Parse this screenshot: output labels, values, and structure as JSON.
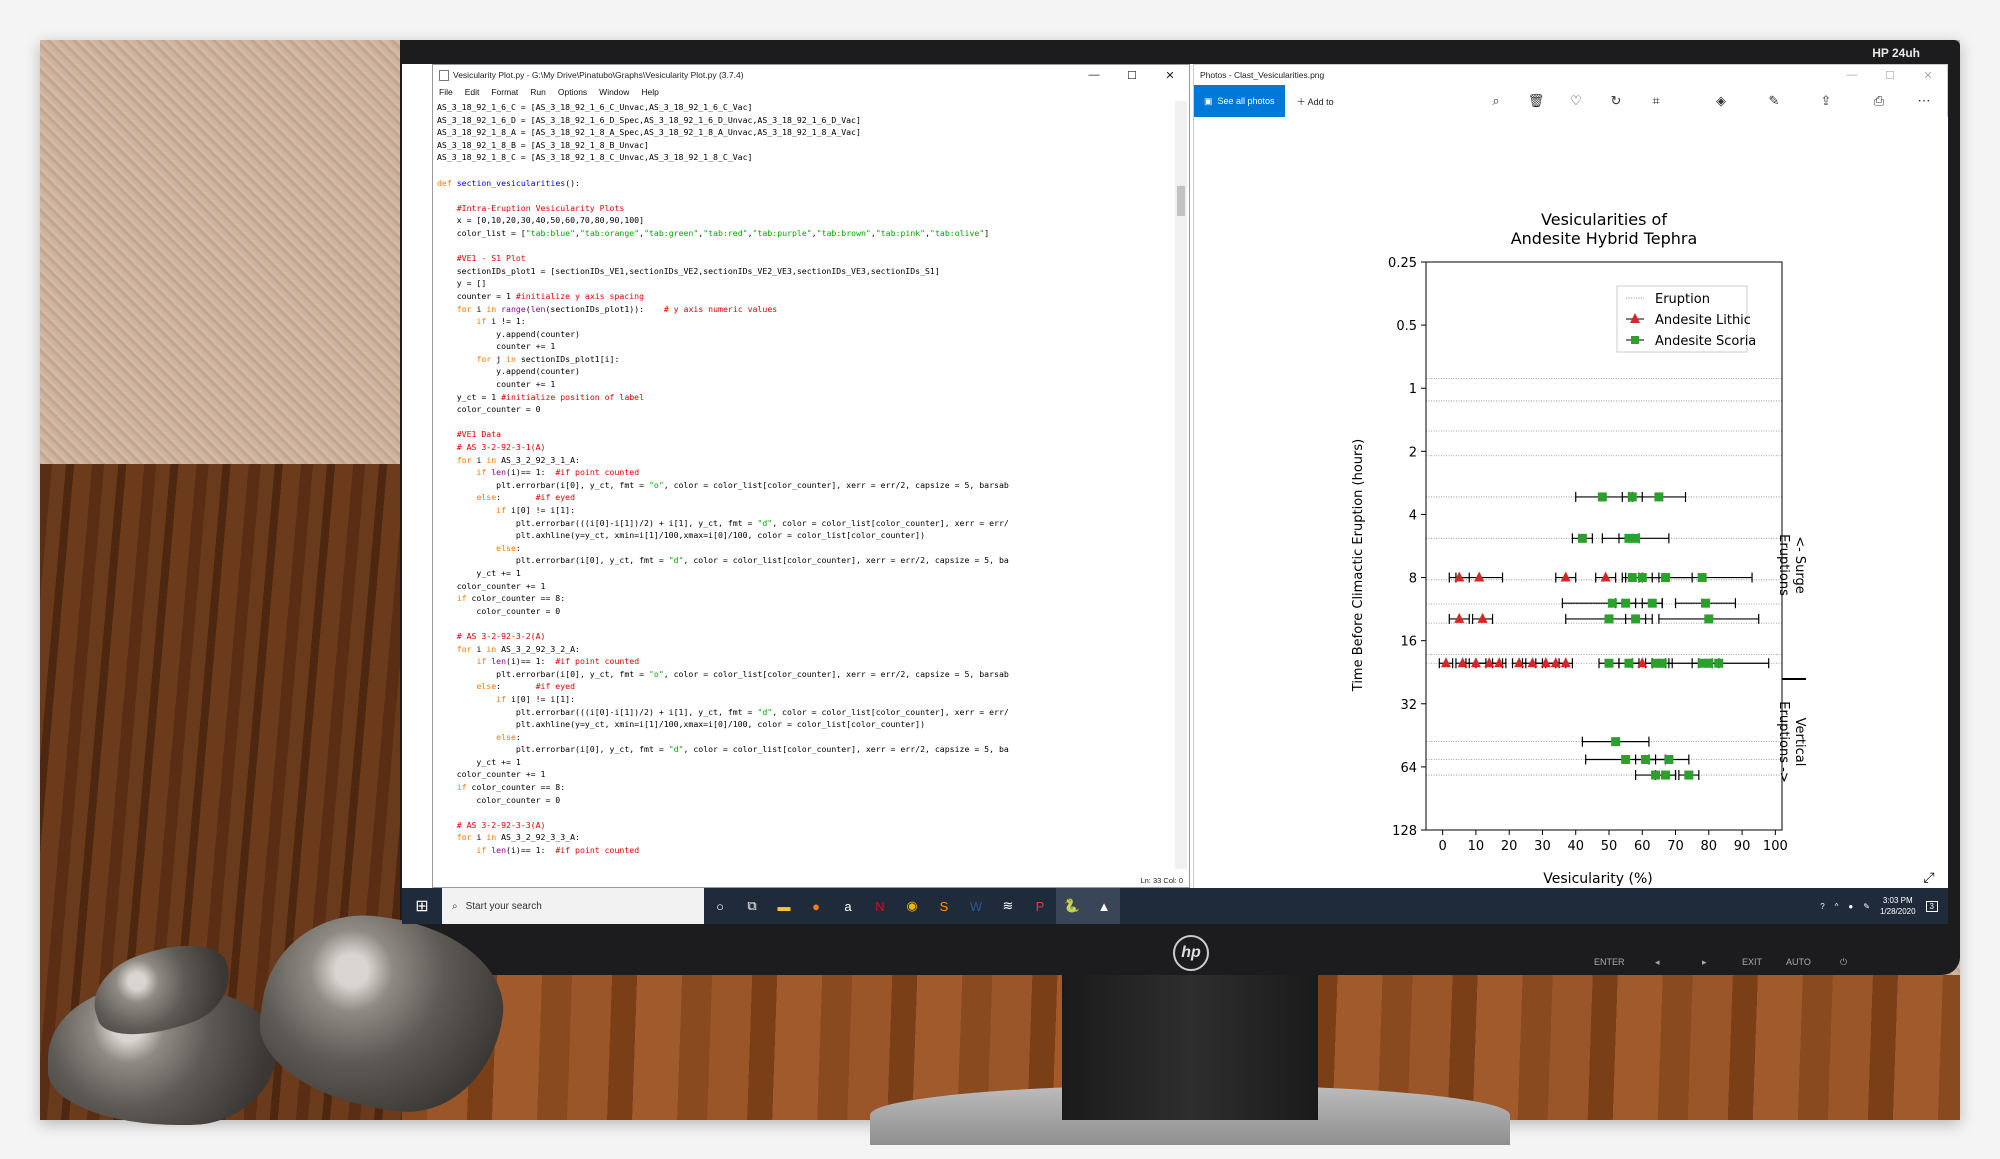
{
  "monitor": {
    "brand": "HP 24uh",
    "logo": "hp",
    "buttons": [
      "ENTER",
      "◂",
      "▸",
      "EXIT",
      "AUTO",
      "⏻"
    ]
  },
  "idle_window": {
    "title": "Vesicularity Plot.py - G:\\My Drive\\Pinatubo\\Graphs\\Vesicularity Plot.py (3.7.4)",
    "menu": [
      "File",
      "Edit",
      "Format",
      "Run",
      "Options",
      "Window",
      "Help"
    ],
    "status": "Ln: 33   Col: 0",
    "code_lines": [
      "AS_3_18_92_1_6_C = [AS_3_18_92_1_6_C_Unvac,AS_3_18_92_1_6_C_Vac]",
      "AS_3_18_92_1_6_D = [AS_3_18_92_1_6_D_Spec,AS_3_18_92_1_6_D_Unvac,AS_3_18_92_1_6_D_Vac]",
      "AS_3_18_92_1_8_A = [AS_3_18_92_1_8_A_Spec,AS_3_18_92_1_8_A_Unvac,AS_3_18_92_1_8_A_Vac]",
      "AS_3_18_92_1_8_B = [AS_3_18_92_1_8_B_Unvac]",
      "AS_3_18_92_1_8_C = [AS_3_18_92_1_8_C_Unvac,AS_3_18_92_1_8_C_Vac]",
      "",
      "def section_vesicularities():",
      "",
      "    #Intra-Eruption Vesicularity Plots",
      "    x = [0,10,20,30,40,50,60,70,80,90,100]",
      "    color_list = [\"tab:blue\",\"tab:orange\",\"tab:green\",\"tab:red\",\"tab:purple\",\"tab:brown\",\"tab:pink\",\"tab:olive\"]",
      "",
      "    #VE1 - S1 Plot",
      "    sectionIDs_plot1 = [sectionIDs_VE1,sectionIDs_VE2,sectionIDs_VE2_VE3,sectionIDs_VE3,sectionIDs_S1]",
      "    y = []",
      "    counter = 1 #initialize y axis spacing",
      "    for i in range(len(sectionIDs_plot1)):    # y axis numeric values",
      "        if i != 1:",
      "            y.append(counter)",
      "            counter += 1",
      "        for j in sectionIDs_plot1[i]:",
      "            y.append(counter)",
      "            counter += 1",
      "    y_ct = 1 #initialize position of label",
      "    color_counter = 0",
      "",
      "    #VE1 Data",
      "    # AS 3-2-92-3-1(A)",
      "    for i in AS_3_2_92_3_1_A:",
      "        if len(i)== 1:  #if point counted",
      "            plt.errorbar(i[0], y_ct, fmt = \"o\", color = color_list[color_counter], xerr = err/2, capsize = 5, barsab",
      "        else:       #if eyed",
      "            if i[0] != i[1]:",
      "                plt.errorbar(((i[0]-i[1])/2) + i[1], y_ct, fmt = \"d\", color = color_list[color_counter], xerr = err/",
      "                plt.axhline(y=y_ct, xmin=i[1]/100,xmax=i[0]/100, color = color_list[color_counter])",
      "            else:",
      "                plt.errorbar(i[0], y_ct, fmt = \"d\", color = color_list[color_counter], xerr = err/2, capsize = 5, ba",
      "        y_ct += 1",
      "    color_counter += 1",
      "    if color_counter == 8:",
      "        color_counter = 0",
      "",
      "    # AS 3-2-92-3-2(A)",
      "    for i in AS_3_2_92_3_2_A:",
      "        if len(i)== 1:  #if point counted",
      "            plt.errorbar(i[0], y_ct, fmt = \"o\", color = color_list[color_counter], xerr = err/2, capsize = 5, barsab",
      "        else:       #if eyed",
      "            if i[0] != i[1]:",
      "                plt.errorbar(((i[0]-i[1])/2) + i[1], y_ct, fmt = \"d\", color = color_list[color_counter], xerr = err/",
      "                plt.axhline(y=y_ct, xmin=i[1]/100,xmax=i[0]/100, color = color_list[color_counter])",
      "            else:",
      "                plt.errorbar(i[0], y_ct, fmt = \"d\", color = color_list[color_counter], xerr = err/2, capsize = 5, ba",
      "        y_ct += 1",
      "    color_counter += 1",
      "    if color_counter == 8:",
      "        color_counter = 0",
      "",
      "    # AS 3-2-92-3-3(A)",
      "    for i in AS_3_2_92_3_3_A:",
      "        if len(i)== 1:  #if point counted"
    ]
  },
  "photos_window": {
    "title": "Photos - Clast_Vesicularities.png",
    "see_all": "See all photos",
    "add_to": "Add to",
    "tool_icons": [
      "zoom-icon",
      "delete-icon",
      "favorite-icon",
      "rotate-icon",
      "crop-icon",
      "enhance-icon",
      "edit-icon",
      "share-icon",
      "print-icon",
      "more-icon"
    ]
  },
  "taskbar": {
    "search_placeholder": "Start your search",
    "time": "3:03 PM",
    "date": "1/28/2020",
    "notification_count": "3"
  },
  "colors": {
    "lithic": "#d62728",
    "scoria": "#2ca02c",
    "taskbar": "#1f2a3a",
    "accent": "#0078d7"
  },
  "chart_data": {
    "type": "scatter",
    "title": "Vesicularities of\nAndesite Hybrid Tephra",
    "title_line1": "Vesicularities of",
    "title_line2": "Andesite Hybrid Tephra",
    "xlabel": "Vesicularity (%)",
    "ylabel": "Time Before Climactic Eruption (hours)",
    "xlim": [
      -5,
      102
    ],
    "ylim_log2": [
      0.25,
      128
    ],
    "y_scale": "log2 (inverted)",
    "x_ticks": [
      "0",
      "10",
      "20",
      "30",
      "40",
      "50",
      "60",
      "70",
      "80",
      "90",
      "100"
    ],
    "y_ticks": [
      "0.25",
      "0.5",
      "1",
      "2",
      "4",
      "8",
      "16",
      "32",
      "64",
      "128"
    ],
    "legend": {
      "location": "top-right",
      "entries": [
        "Eruption",
        "Andesite Lithic",
        "Andesite Scoria"
      ]
    },
    "right_annotations": [
      "<- Surge\nEruptions",
      "Vertical\nEruptions ->"
    ],
    "annot_top_1": "<- Surge",
    "annot_top_2": "Eruptions",
    "annot_bot_1": "Vertical",
    "annot_bot_2": "Eruptions ->",
    "eruption_lines_hours": [
      0.25,
      0.9,
      1.15,
      1.6,
      2.1,
      3.3,
      5.2,
      8.2,
      10.7,
      13.2,
      18.6,
      20.5,
      48.5,
      59,
      70
    ],
    "points": [
      {
        "y": 3.3,
        "x": 48,
        "err": 8,
        "type": "Andesite Scoria"
      },
      {
        "y": 3.3,
        "x": 57,
        "err": 3,
        "type": "Andesite Scoria"
      },
      {
        "y": 3.3,
        "x": 65,
        "err": 8,
        "type": "Andesite Scoria"
      },
      {
        "y": 5.2,
        "x": 42,
        "err": 3,
        "type": "Andesite Scoria"
      },
      {
        "y": 5.2,
        "x": 56,
        "err": 3,
        "type": "Andesite Scoria"
      },
      {
        "y": 5.2,
        "x": 58,
        "err": 10,
        "type": "Andesite Scoria"
      },
      {
        "y": 8.0,
        "x": 5,
        "err": 3,
        "type": "Andesite Lithic"
      },
      {
        "y": 8.0,
        "x": 11,
        "err": 7,
        "type": "Andesite Lithic"
      },
      {
        "y": 8.0,
        "x": 37,
        "err": 3,
        "type": "Andesite Lithic"
      },
      {
        "y": 8.0,
        "x": 49,
        "err": 3,
        "type": "Andesite Lithic"
      },
      {
        "y": 8.0,
        "x": 57,
        "err": 3,
        "type": "Andesite Scoria"
      },
      {
        "y": 8.0,
        "x": 60,
        "err": 5,
        "type": "Andesite Scoria"
      },
      {
        "y": 8.0,
        "x": 67,
        "err": 8,
        "type": "Andesite Scoria"
      },
      {
        "y": 8.0,
        "x": 78,
        "err": 15,
        "type": "Andesite Scoria"
      },
      {
        "y": 10.6,
        "x": 51,
        "err": 15,
        "type": "Andesite Scoria"
      },
      {
        "y": 10.6,
        "x": 55,
        "err": 3,
        "type": "Andesite Scoria"
      },
      {
        "y": 10.6,
        "x": 63,
        "err": 3,
        "type": "Andesite Scoria"
      },
      {
        "y": 10.6,
        "x": 79,
        "err": 9,
        "type": "Andesite Scoria"
      },
      {
        "y": 12.6,
        "x": 5,
        "err": 3,
        "type": "Andesite Lithic"
      },
      {
        "y": 12.6,
        "x": 12,
        "err": 3,
        "type": "Andesite Lithic"
      },
      {
        "y": 12.6,
        "x": 50,
        "err": 13,
        "type": "Andesite Scoria"
      },
      {
        "y": 12.6,
        "x": 58,
        "err": 3,
        "type": "Andesite Scoria"
      },
      {
        "y": 12.6,
        "x": 80,
        "err": 15,
        "type": "Andesite Scoria"
      },
      {
        "y": 20.5,
        "x": 1,
        "err": 2,
        "type": "Andesite Lithic"
      },
      {
        "y": 20.5,
        "x": 6,
        "err": 2,
        "type": "Andesite Lithic"
      },
      {
        "y": 20.5,
        "x": 10,
        "err": 3,
        "type": "Andesite Lithic"
      },
      {
        "y": 20.5,
        "x": 14,
        "err": 4,
        "type": "Andesite Lithic"
      },
      {
        "y": 20.5,
        "x": 17,
        "err": 2,
        "type": "Andesite Lithic"
      },
      {
        "y": 20.5,
        "x": 23,
        "err": 2,
        "type": "Andesite Lithic"
      },
      {
        "y": 20.5,
        "x": 27,
        "err": 3,
        "type": "Andesite Lithic"
      },
      {
        "y": 20.5,
        "x": 31,
        "err": 3,
        "type": "Andesite Lithic"
      },
      {
        "y": 20.5,
        "x": 34,
        "err": 3,
        "type": "Andesite Lithic"
      },
      {
        "y": 20.5,
        "x": 37,
        "err": 2,
        "type": "Andesite Lithic"
      },
      {
        "y": 20.5,
        "x": 50,
        "err": 3,
        "type": "Andesite Scoria"
      },
      {
        "y": 20.5,
        "x": 56,
        "err": 3,
        "type": "Andesite Scoria"
      },
      {
        "y": 20.5,
        "x": 60,
        "err": 3,
        "type": "Andesite Lithic"
      },
      {
        "y": 20.5,
        "x": 64,
        "err": 3,
        "type": "Andesite Scoria"
      },
      {
        "y": 20.5,
        "x": 66,
        "err": 3,
        "type": "Andesite Scoria"
      },
      {
        "y": 20.5,
        "x": 78,
        "err": 3,
        "type": "Andesite Scoria"
      },
      {
        "y": 20.5,
        "x": 80,
        "err": 3,
        "type": "Andesite Scoria"
      },
      {
        "y": 20.5,
        "x": 83,
        "err": 15,
        "type": "Andesite Scoria"
      },
      {
        "y": 48.5,
        "x": 52,
        "err": 10,
        "type": "Andesite Scoria"
      },
      {
        "y": 59,
        "x": 55,
        "err": 12,
        "type": "Andesite Scoria"
      },
      {
        "y": 59,
        "x": 61,
        "err": 3,
        "type": "Andesite Scoria"
      },
      {
        "y": 59,
        "x": 68,
        "err": 6,
        "type": "Andesite Scoria"
      },
      {
        "y": 70,
        "x": 64,
        "err": 6,
        "type": "Andesite Scoria"
      },
      {
        "y": 70,
        "x": 67,
        "err": 3,
        "type": "Andesite Scoria"
      },
      {
        "y": 70,
        "x": 74,
        "err": 3,
        "type": "Andesite Scoria"
      }
    ]
  }
}
